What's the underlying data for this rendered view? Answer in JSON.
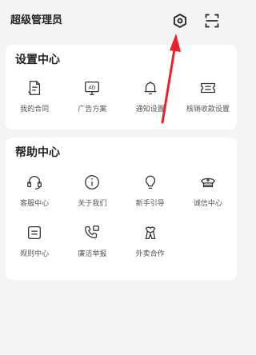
{
  "header": {
    "title": "超级管理员",
    "settings_icon": "settings-icon",
    "scan_icon": "scan-icon"
  },
  "settings_section": {
    "title": "设置中心",
    "items": [
      {
        "label": "我的合同",
        "icon": "contract-icon"
      },
      {
        "label": "广告方案",
        "icon": "ad-icon"
      },
      {
        "label": "通知设置",
        "icon": "bell-icon"
      },
      {
        "label": "核销收款设置",
        "icon": "ticket-icon"
      }
    ]
  },
  "help_section": {
    "title": "帮助中心",
    "items": [
      {
        "label": "客服中心",
        "icon": "headset-icon"
      },
      {
        "label": "关于我们",
        "icon": "info-icon"
      },
      {
        "label": "新手引导",
        "icon": "bulb-icon"
      },
      {
        "label": "诚信中心",
        "icon": "police-cap-icon"
      },
      {
        "label": "规则中心",
        "icon": "rules-icon"
      },
      {
        "label": "廉洁举报",
        "icon": "report-phone-icon"
      },
      {
        "label": "外卖合作",
        "icon": "cooperation-icon"
      }
    ]
  },
  "colors": {
    "background": "#f4f4f4",
    "card": "#ffffff",
    "annotation_arrow": "#e8212b"
  }
}
